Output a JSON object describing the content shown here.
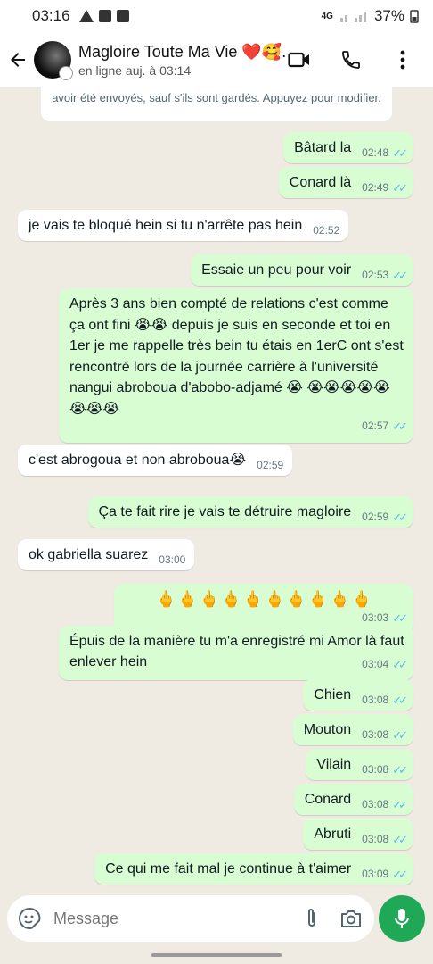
{
  "status_bar": {
    "time": "03:16",
    "network": "4G",
    "battery": "37%"
  },
  "header": {
    "contact_name": "Magloire Toute Ma Vie ❤️🥰...",
    "presence": "en ligne auj. à 03:14"
  },
  "system_notice": "avoir été envoyés, sauf s'ils sont gardés. Appuyez pour modifier.",
  "messages": [
    {
      "dir": "out",
      "text": "Bâtard la",
      "time": "02:48"
    },
    {
      "dir": "out",
      "text": "Conard là",
      "time": "02:49"
    },
    {
      "dir": "in",
      "text": "je vais te bloqué hein si tu n'arrête pas hein",
      "time": "02:52"
    },
    {
      "dir": "out",
      "text": "Essaie un peu pour voir",
      "time": "02:53"
    },
    {
      "dir": "out",
      "text": "Après 3 ans bien compté de relations c'est comme ça ont fini 😭😭 depuis je suis en seconde et toi en 1er je me rappelle très bein tu étais en 1erC ont s'est rencontré lors de la journée carrière à l'université nangui abroboua d'abobo-adjamé 😭 😭😭😭😭😭😭😭😭",
      "time": "02:57"
    },
    {
      "dir": "in",
      "text": "c'est abrogoua et non abroboua😭",
      "time": "02:59"
    },
    {
      "dir": "out",
      "text": "Ça te fait rire je vais te détruire magloire",
      "time": "02:59"
    },
    {
      "dir": "in",
      "text": "ok gabriella suarez",
      "time": "03:00"
    },
    {
      "dir": "out",
      "text": "🖕🖕🖕🖕🖕🖕🖕🖕🖕🖕",
      "time": "03:03"
    },
    {
      "dir": "out",
      "text": "Épuis de la manière tu m'a enregistré mi Amor là faut enlever hein",
      "time": "03:04"
    },
    {
      "dir": "out",
      "text": "Chien",
      "time": "03:08"
    },
    {
      "dir": "out",
      "text": "Mouton",
      "time": "03:08"
    },
    {
      "dir": "out",
      "text": "Vilain",
      "time": "03:08"
    },
    {
      "dir": "out",
      "text": "Conard",
      "time": "03:08"
    },
    {
      "dir": "out",
      "text": "Abruti",
      "time": "03:08"
    },
    {
      "dir": "out",
      "text": "Ce qui me fait mal je continue à t'aimer",
      "time": "03:09"
    }
  ],
  "input": {
    "placeholder": "Message"
  },
  "icons": {
    "back": "arrow-left-icon",
    "video": "video-call-icon",
    "call": "phone-icon",
    "menu": "more-vert-icon",
    "sticker": "sticker-icon",
    "attach": "paperclip-icon",
    "camera": "camera-icon",
    "mic": "microphone-icon"
  },
  "colors": {
    "outgoing": "#d9fdd3",
    "incoming": "#ffffff",
    "mic_button": "#1fa855",
    "read_ticks": "#53bdeb"
  }
}
